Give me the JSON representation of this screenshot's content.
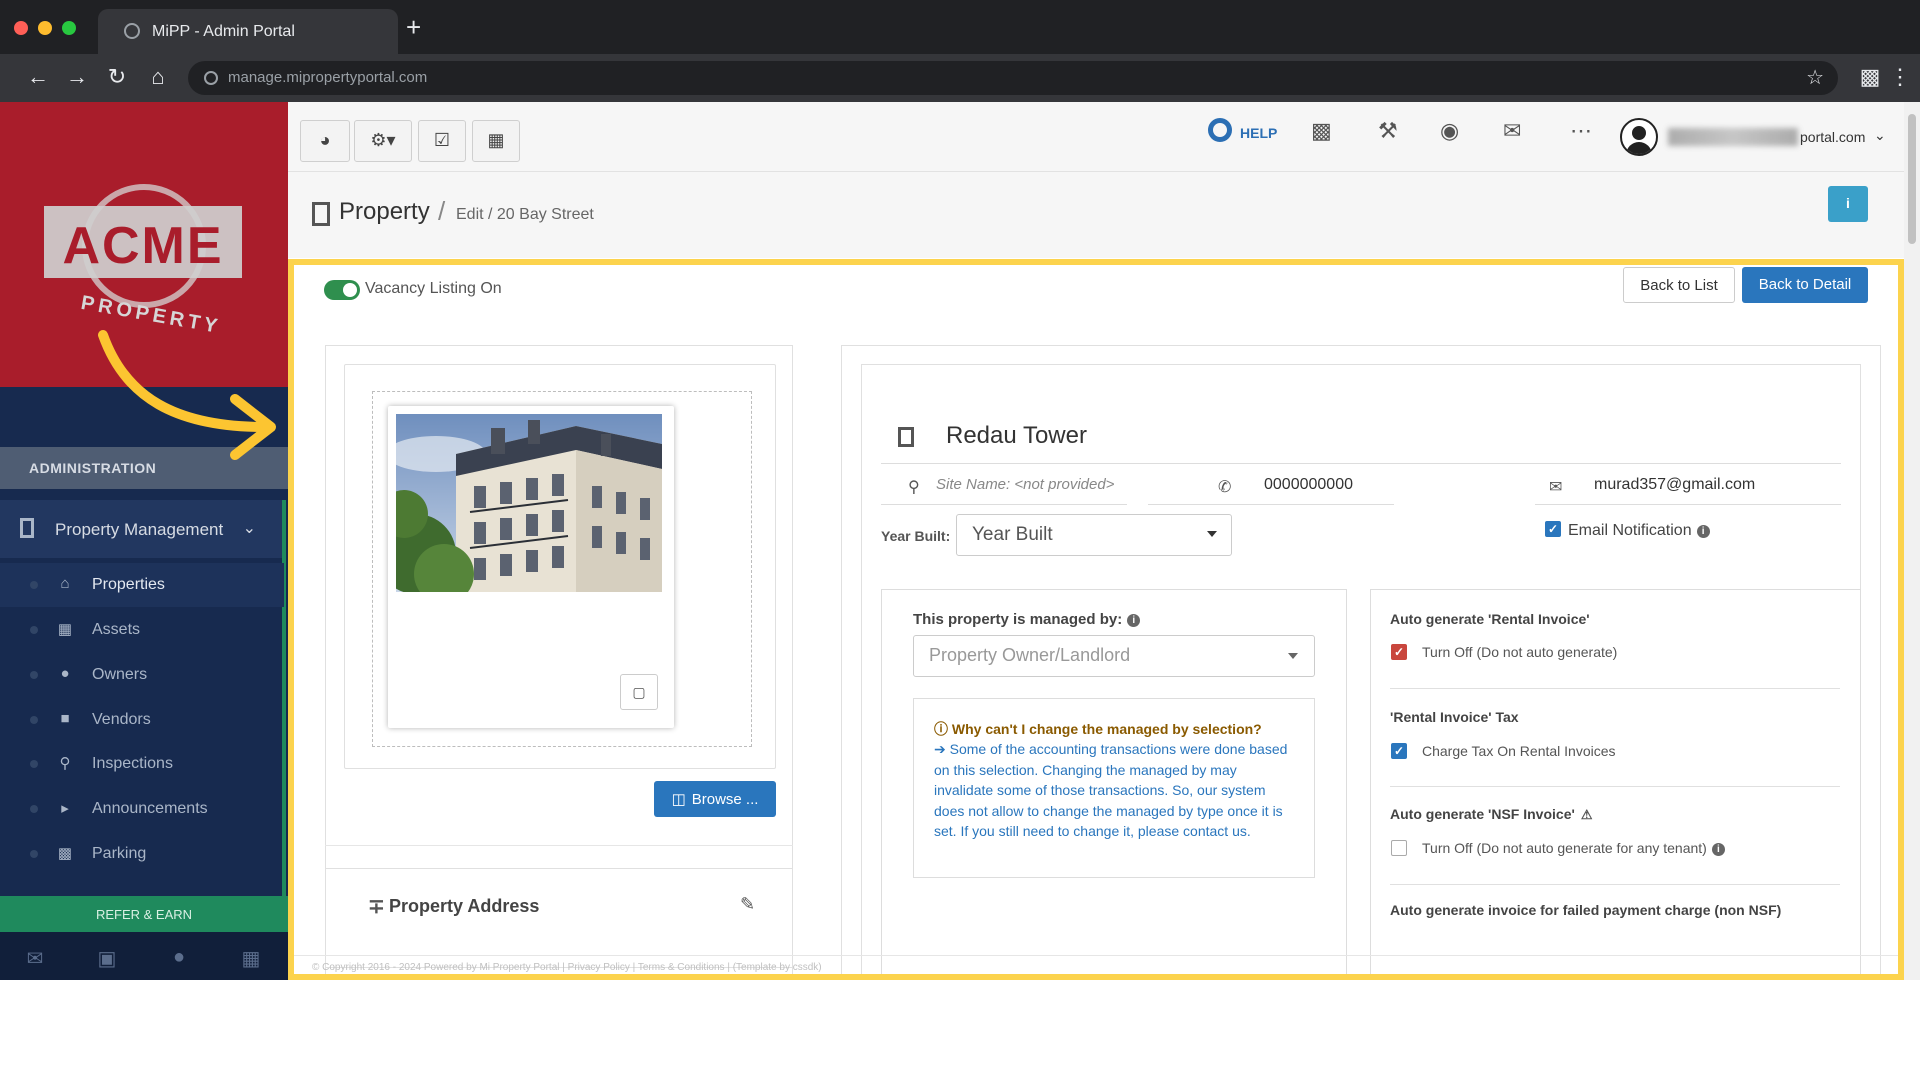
{
  "browser": {
    "tab_title": "MiPP - Admin Portal",
    "new_tab": "+",
    "url": "manage.mipropertyportal.com"
  },
  "sidebar": {
    "logo_text": "ACME",
    "logo_subtext": "PROPERTY",
    "section_header": "ADMINISTRATION",
    "group_label": "Property Management",
    "items": [
      {
        "label": "Properties",
        "icon": "home-icon",
        "active": true
      },
      {
        "label": "Assets",
        "icon": "assets-icon"
      },
      {
        "label": "Owners",
        "icon": "user-icon"
      },
      {
        "label": "Vendors",
        "icon": "briefcase-icon"
      },
      {
        "label": "Inspections",
        "icon": "search-icon"
      },
      {
        "label": "Announcements",
        "icon": "bullhorn-icon"
      },
      {
        "label": "Parking",
        "icon": "car-icon"
      }
    ],
    "refer_label": "REFER & EARN",
    "footer_icons": [
      "envelope-icon",
      "briefcase-icon",
      "user-icon",
      "calculator-icon"
    ]
  },
  "header": {
    "help_label": "HELP",
    "user_email_visible": "portal.com",
    "icons": [
      "dashboard-icon",
      "settings-icon",
      "calendar-icon",
      "calculator-icon",
      "chart-icon",
      "wrench-icon",
      "eye-icon",
      "envelope-icon",
      "more-icon"
    ]
  },
  "page": {
    "title": "Property",
    "separator": "/",
    "breadcrumb": "Edit / 20 Bay Street",
    "info_label": "i"
  },
  "form": {
    "vacancy_label": "Vacancy Listing On",
    "vacancy_on": true,
    "back_to_list": "Back to List",
    "back_to_detail": "Back to Detail",
    "browse_label": "Browse ...",
    "address_title": "Property Address",
    "property_name": "Redau Tower",
    "site_name_placeholder": "Site Name: <not provided>",
    "phone": "0000000000",
    "email": "murad357@gmail.com",
    "year_built_label": "Year Built:",
    "year_built_value": "Year Built",
    "email_notification_label": "Email Notification",
    "email_notification_checked": true,
    "managed_by_label": "This property is managed by:",
    "managed_by_value": "Property Owner/Landlord",
    "note_question": "Why can't I change the managed by selection?",
    "note_text": "Some of the accounting transactions were done based on this selection. Changing the managed by may invalidate some of those transactions. So, our system does not allow to change the managed by type once it is set. If you still need to change it, please contact us."
  },
  "invoice_settings": {
    "rental_invoice_title": "Auto generate 'Rental Invoice'",
    "rental_invoice_option": "Turn Off (Do not auto generate)",
    "rental_invoice_checked": true,
    "tax_title": "'Rental Invoice' Tax",
    "tax_option": "Charge Tax On Rental Invoices",
    "tax_checked": true,
    "nsf_title": "Auto generate 'NSF Invoice'",
    "nsf_option": "Turn Off (Do not auto generate for any tenant)",
    "nsf_checked": false,
    "failed_payment_title": "Auto generate invoice for failed payment charge (non NSF)"
  },
  "footer": {
    "text": "© Copyright 2016 - 2024 Powered by Mi Property Portal | Privacy Policy | Terms & Conditions | (Template by cssdk)"
  },
  "colors": {
    "sidebar_bg": "#172a4f",
    "brand_red": "#a91d2b",
    "primary_blue": "#2a76bd",
    "highlight_yellow": "#fcd34d",
    "refer_green": "#1f8a5d"
  }
}
